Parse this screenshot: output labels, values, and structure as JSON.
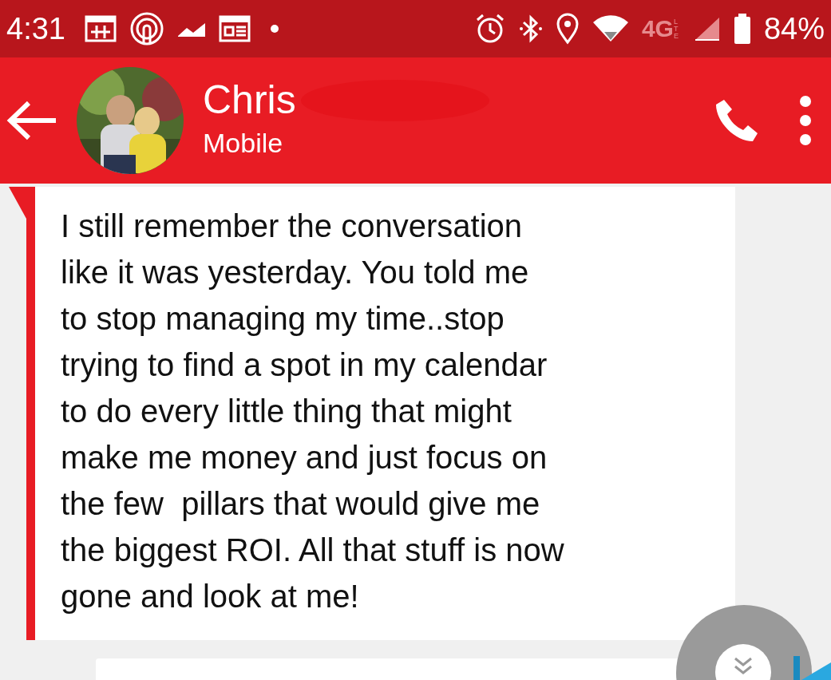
{
  "status_bar": {
    "time": "4:31",
    "network": "4G",
    "network_sub": "LTE",
    "battery": "84%"
  },
  "header": {
    "name": "Chris",
    "subtitle": "Mobile"
  },
  "message": {
    "lines": [
      "I still remember the conversation",
      "like it was yesterday. You told me",
      "to stop managing my time..stop",
      "trying to find a spot in my calendar",
      "to do every little thing that might",
      "make me money and just focus on",
      "the few  pillars that would give me",
      "the biggest ROI. All that stuff is now",
      "gone and look at me!"
    ]
  }
}
